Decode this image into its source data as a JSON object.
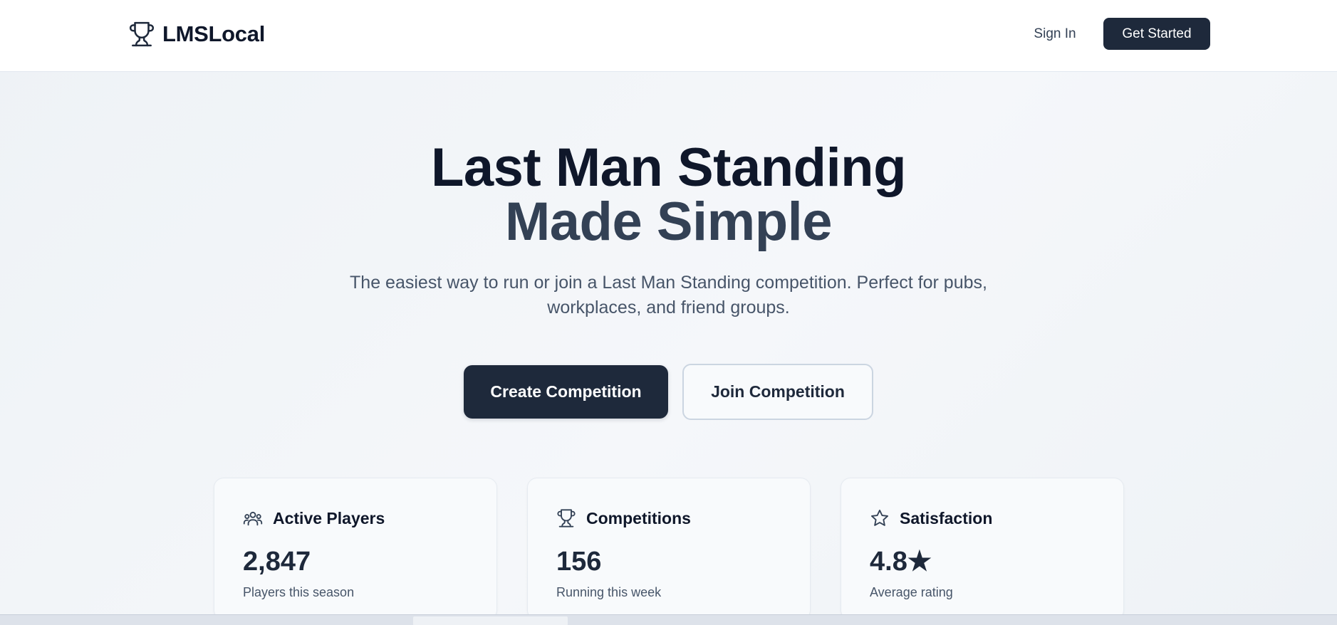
{
  "header": {
    "brand": "LMSLocal",
    "brand_icon": "trophy-icon",
    "sign_in": "Sign In",
    "get_started": "Get Started"
  },
  "hero": {
    "title_line1": "Last Man Standing",
    "title_line2": "Made Simple",
    "subtitle": "The easiest way to run or join a Last Man Standing competition. Perfect for pubs, workplaces, and friend groups.",
    "primary_button": "Create Competition",
    "secondary_button": "Join Competition"
  },
  "stats": [
    {
      "icon": "users-icon",
      "title": "Active Players",
      "value": "2,847",
      "caption": "Players this season"
    },
    {
      "icon": "trophy-icon",
      "title": "Competitions",
      "value": "156",
      "caption": "Running this week"
    },
    {
      "icon": "star-icon",
      "title": "Satisfaction",
      "value": "4.8★",
      "caption": "Average rating"
    }
  ],
  "colors": {
    "primary": "#1e293b",
    "heading": "#0f172a",
    "heading_secondary": "#334155",
    "muted_text": "#475569",
    "background": "#f1f5f9"
  }
}
